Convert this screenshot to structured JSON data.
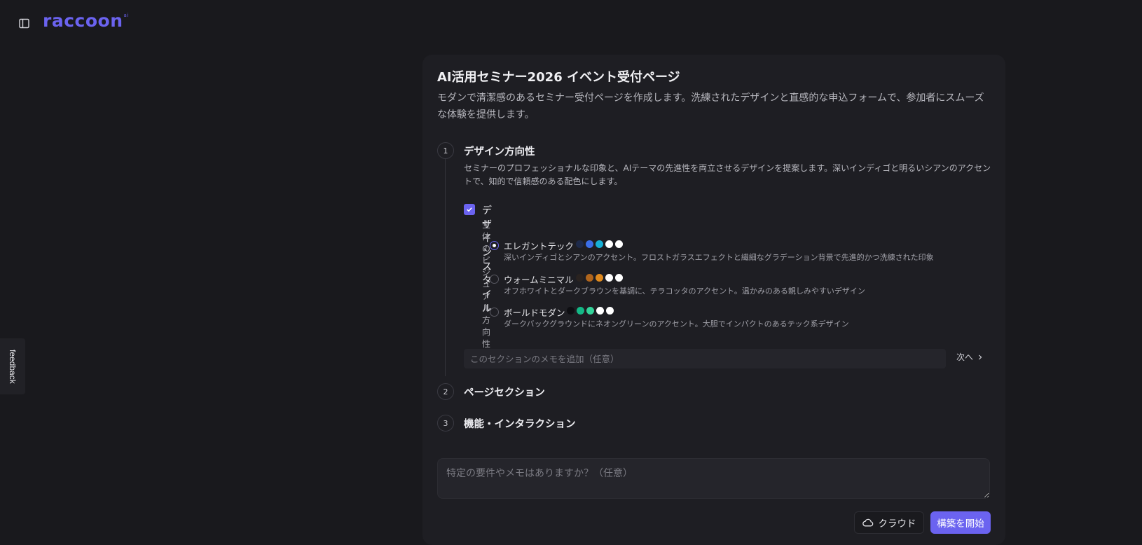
{
  "header": {
    "logo_text": "raccoon",
    "logo_badge": "ai",
    "sidebar_toggle_icon": "sidebar-toggle-icon"
  },
  "feedback": {
    "label": "feedback"
  },
  "card": {
    "title": "AI活用セミナー2026 イベント受付ページ",
    "description": "モダンで清潔感のあるセミナー受付ページを作成します。洗練されたデザインと直感的な申込フォームで、参加者にスムーズな体験を提供します。"
  },
  "steps": [
    {
      "number": "1",
      "title": "デザイン方向性",
      "description": "セミナーのプロフェッショナルな印象と、AIテーマの先進性を両立させるデザインを提案します。深いインディゴと明るいシアンのアクセントで、知的で信頼感のある配色にします。",
      "group": {
        "title": "デザインスタイル",
        "subtitle": "全体のビジュアル方向性",
        "checked": true
      },
      "options": [
        {
          "name": "エレガントテック",
          "description": "深いインディゴとシアンのアクセント。フロストガラスエフェクトと繊細なグラデーション背景で先進的かつ洗練された印象",
          "selected": true,
          "colors": [
            "#1e2a4a",
            "#3b6ee8",
            "#17b0d6",
            "#ffffff",
            "#ffffff"
          ]
        },
        {
          "name": "ウォームミニマル",
          "description": "オフホワイトとダークブラウンを基調に、テラコッタのアクセント。温かみのある親しみやすいデザイン",
          "selected": false,
          "colors": [
            "#2a2320",
            "#b0651c",
            "#e08a1e",
            "#ffffff",
            "#ffffff"
          ]
        },
        {
          "name": "ボールドモダン",
          "description": "ダークバックグラウンドにネオングリーンのアクセント。大胆でインパクトのあるテック系デザイン",
          "selected": false,
          "colors": [
            "#0e0e12",
            "#14b886",
            "#34d39a",
            "#ffffff",
            "#ffffff"
          ]
        }
      ],
      "memo_placeholder": "このセクションのメモを追加（任意）",
      "next_label": "次へ"
    },
    {
      "number": "2",
      "title": "ページセクション"
    },
    {
      "number": "3",
      "title": "機能・インタラクション"
    }
  ],
  "footer": {
    "textarea_placeholder": "特定の要件やメモはありますか？（任意）",
    "cloud_label": "クラウド",
    "build_label": "構築を開始"
  },
  "colors": {
    "accent": "#6b63f0",
    "background": "#19191d",
    "card": "#1e1e23"
  }
}
